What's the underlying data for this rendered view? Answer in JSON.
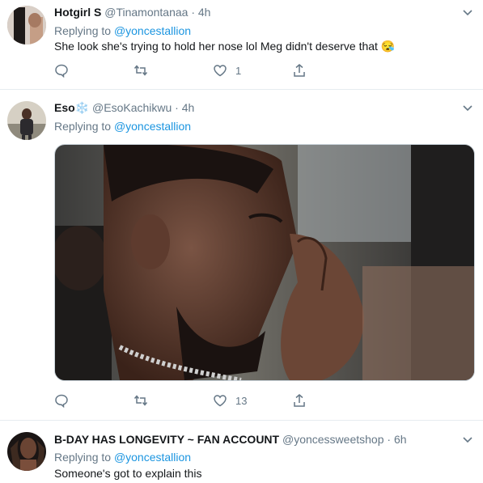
{
  "tweets": [
    {
      "name": "Hotgirl S",
      "handle": "@Tinamontanaa",
      "separator": "·",
      "time": "4h",
      "text": "She look she's trying to hold her nose lol Meg didn't deserve that 😪",
      "likes": "1"
    },
    {
      "name": "Eso",
      "name_emoji": "❄️",
      "handle": "@EsoKachikwu",
      "separator": "·",
      "time": "4h",
      "reply_prefix": "Replying to",
      "reply_to": "@yoncestallion",
      "likes": "13"
    },
    {
      "name": "B-DAY HAS LONGEVITY ~ FAN ACCOUNT",
      "handle": "@yoncessweetshop",
      "separator": "·",
      "time": "6h",
      "reply_prefix": "Replying to",
      "reply_to": "@yoncestallion",
      "text": "Someone's got to explain this"
    }
  ],
  "first_reply": {
    "reply_prefix": "Replying to",
    "reply_to": "@yoncestallion"
  }
}
